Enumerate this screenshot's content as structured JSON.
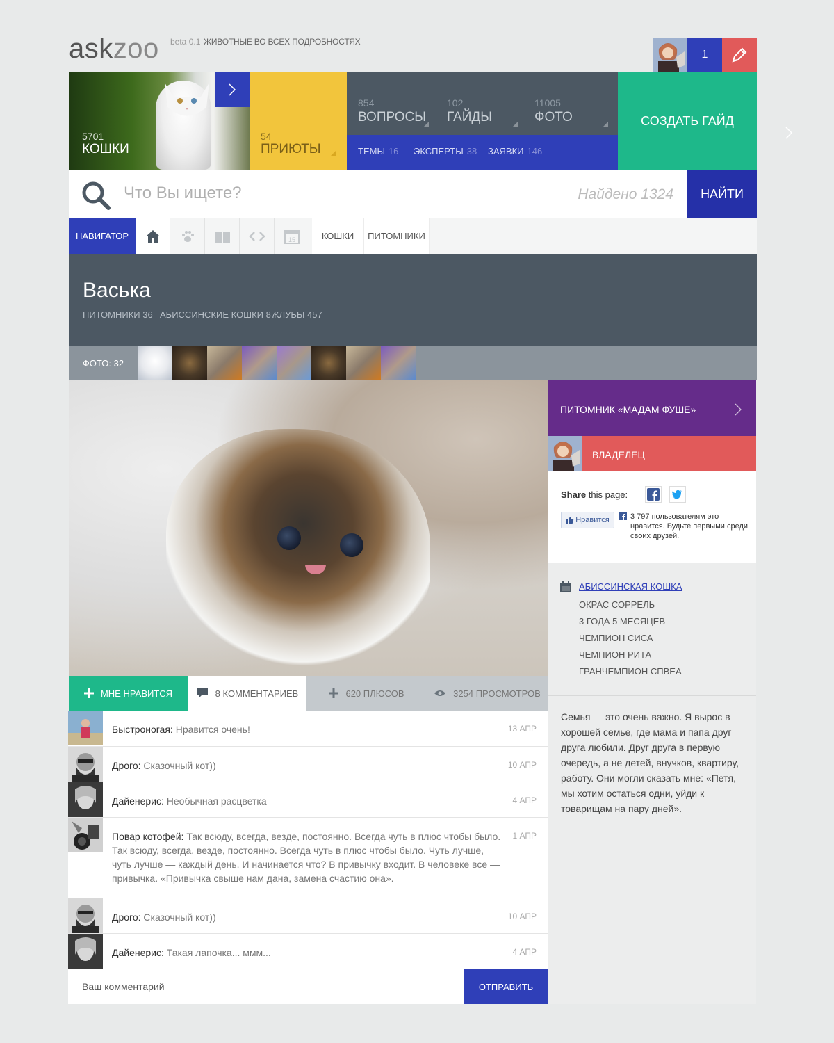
{
  "header": {
    "logo_part1": "ask",
    "logo_part2": "zoo",
    "beta": "beta 0.1",
    "tagline": "ЖИВОТНЫЕ ВО ВСЕХ ПОДРОБНОСТЯХ",
    "notifications_count": "1"
  },
  "tiles": {
    "cats": {
      "count": "5701",
      "label": "КОШКИ"
    },
    "shelters": {
      "count": "54",
      "label": "ПРИЮТЫ"
    },
    "questions": {
      "count": "854",
      "label": "ВОПРОСЫ"
    },
    "guides": {
      "count": "102",
      "label": "ГАЙДЫ"
    },
    "photos": {
      "count": "11005",
      "label": "ФОТО"
    },
    "topics": {
      "label": "ТЕМЫ",
      "count": "16"
    },
    "experts": {
      "label": "ЭКСПЕРТЫ",
      "count": "38"
    },
    "requests": {
      "label": "ЗАЯВКИ",
      "count": "146"
    },
    "create_guide": "СОЗДАТЬ ГАЙД"
  },
  "search": {
    "placeholder": "Что Вы ищете?",
    "found": "Найдено 1324",
    "button": "НАЙТИ"
  },
  "navigator": {
    "title": "НАВИГАТОР",
    "crumbs": [
      "КОШКИ",
      "ПИТОМНИКИ"
    ]
  },
  "pet": {
    "name": "Васька",
    "tags": [
      "ПИТОМНИКИ 36",
      "АБИССИНСКИЕ КОШКИ 87",
      "КЛУБЫ 457"
    ],
    "photos_label": "ФОТО: 32"
  },
  "actions": {
    "like": "МНЕ НРАВИТСЯ",
    "comments": "8 КОММЕНТАРИЕВ",
    "pluses": "620 ПЛЮСОВ",
    "views": "3254 ПРОСМОТРОВ"
  },
  "comments": [
    {
      "author": "Быстроногая:",
      "text": "Нравится очень!",
      "date": "13 АПР"
    },
    {
      "author": "Дрого:",
      "text": "Сказочный кот))",
      "date": "10 АПР"
    },
    {
      "author": "Дайенерис:",
      "text": "Необычная расцветка",
      "date": "4 АПР"
    },
    {
      "author": "Повар котофей:",
      "text": "Так всюду, всегда, везде, постоянно. Всегда чуть в плюс чтобы было. Так всюду, всегда, везде, постоянно. Всегда чуть в плюс чтобы было. Чуть лучше, чуть лучше — каждый день. И начинается что? В привычку входит. В человеке все — привычка. «Привычка свыше нам дана, замена счастию она».",
      "date": "1 АПР"
    },
    {
      "author": "Дрого:",
      "text": "Сказочный кот))",
      "date": "10 АПР"
    },
    {
      "author": "Дайенерис:",
      "text": "Такая лапочка... ммм...",
      "date": "4 АПР"
    }
  ],
  "comment_form": {
    "placeholder": "Ваш комментарий",
    "submit": "ОТПРАВИТЬ"
  },
  "sidebar": {
    "kennel": "ПИТОМНИК «МАДАМ ФУШЕ»",
    "owner": "ВЛАДЕЛЕЦ",
    "share_bold": "Share",
    "share_rest": "this page:",
    "fb_like": "Нравится",
    "fb_text": "3 797 пользователям это нравится. Будьте первыми среди своих друзей.",
    "facts": [
      "АБИССИНСКАЯ КОШКА",
      "ОКРАС СОРРЕЛЬ",
      "3 ГОДА 5 МЕСЯЦЕВ",
      "ЧЕМПИОН СИСА",
      "ЧЕМПИОН РИТА",
      "ГРАНЧЕМПИОН СПВЕА"
    ],
    "about": "Семья — это очень важно. Я вырос в хорошей семье, где мама и папа друг друга любили. Друг друга в первую очередь, а не детей, внучков, квартиру, работу. Они могли сказать мне: «Петя, мы хотим остаться одни, уйди к товарищам на пару дней»."
  },
  "colors": {
    "blue": "#2f3fb8",
    "yellow": "#f2c53c",
    "slate": "#4c5863",
    "green": "#1eb88a",
    "red": "#e15a5a",
    "purple": "#652c8a"
  }
}
